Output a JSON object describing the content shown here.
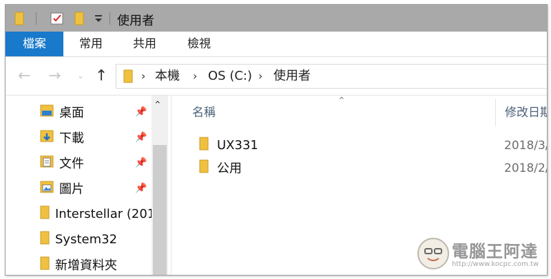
{
  "window": {
    "title": "使用者"
  },
  "quick_access": {
    "icons": [
      "folder-icon",
      "properties-checkbox-icon",
      "new-folder-icon",
      "customize-dropdown-icon"
    ]
  },
  "ribbon": {
    "tabs": [
      {
        "label": "檔案",
        "active": true
      },
      {
        "label": "常用"
      },
      {
        "label": "共用"
      },
      {
        "label": "檢視"
      }
    ],
    "accent_color": "#1979ca"
  },
  "address": {
    "back_icon": "back-arrow-icon",
    "forward_icon": "forward-arrow-icon",
    "recent_icon": "chevron-down-icon",
    "up_icon": "up-arrow-icon",
    "crumbs": [
      "本機",
      "OS (C:)",
      "使用者"
    ]
  },
  "nav_pane": {
    "items": [
      {
        "label": "桌面",
        "icon": "desktop-folder-icon",
        "pinned": true
      },
      {
        "label": "下載",
        "icon": "downloads-folder-icon",
        "pinned": true
      },
      {
        "label": "文件",
        "icon": "documents-folder-icon",
        "pinned": true
      },
      {
        "label": "圖片",
        "icon": "pictures-folder-icon",
        "pinned": true
      },
      {
        "label": "Interstellar (201",
        "icon": "folder-icon",
        "pinned": false
      },
      {
        "label": "System32",
        "icon": "folder-icon",
        "pinned": false
      },
      {
        "label": "新增資料夾",
        "icon": "folder-icon",
        "pinned": false
      }
    ]
  },
  "content": {
    "columns": [
      "名稱",
      "修改日期"
    ],
    "rows": [
      {
        "name": "UX331",
        "date": "2018/3/"
      },
      {
        "name": "公用",
        "date": "2018/2/"
      }
    ]
  },
  "watermark": {
    "title": "電腦王阿達",
    "url": "http://www.kocpc.com.tw"
  }
}
